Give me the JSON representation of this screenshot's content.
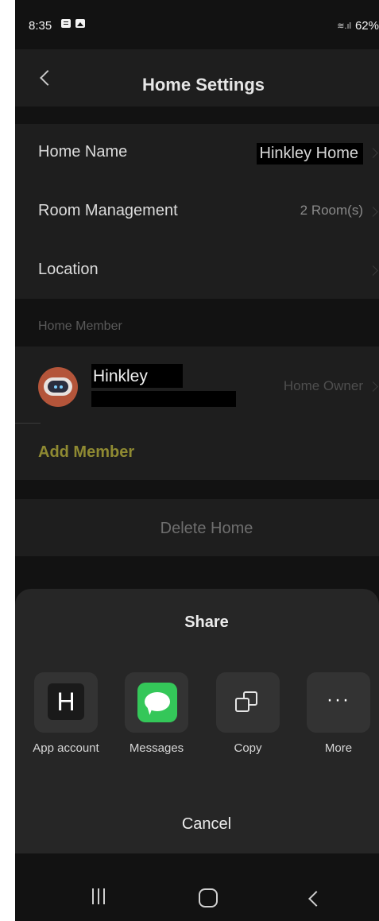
{
  "status_bar": {
    "time": "8:35",
    "battery": "62%"
  },
  "header": {
    "title": "Home Settings"
  },
  "settings": {
    "home_name": {
      "label": "Home Name",
      "value": "Hinkley Home"
    },
    "room_management": {
      "label": "Room Management",
      "value": "2 Room(s)"
    },
    "location": {
      "label": "Location"
    }
  },
  "members": {
    "section_label": "Home Member",
    "items": [
      {
        "name": "Hinkley",
        "role": "Home Owner"
      }
    ],
    "add_label": "Add Member"
  },
  "delete_label": "Delete Home",
  "share_sheet": {
    "title": "Share",
    "options": [
      {
        "label": "App account",
        "icon": "app-account-icon",
        "glyph": "H"
      },
      {
        "label": "Messages",
        "icon": "messages-icon"
      },
      {
        "label": "Copy",
        "icon": "copy-icon"
      },
      {
        "label": "More",
        "icon": "more-icon",
        "glyph": "···"
      }
    ],
    "cancel_label": "Cancel"
  },
  "colors": {
    "background": "#121212",
    "card": "#1e1e1e",
    "sheet": "#262626",
    "accent": "#8f8a32",
    "messages_green": "#34c759"
  }
}
